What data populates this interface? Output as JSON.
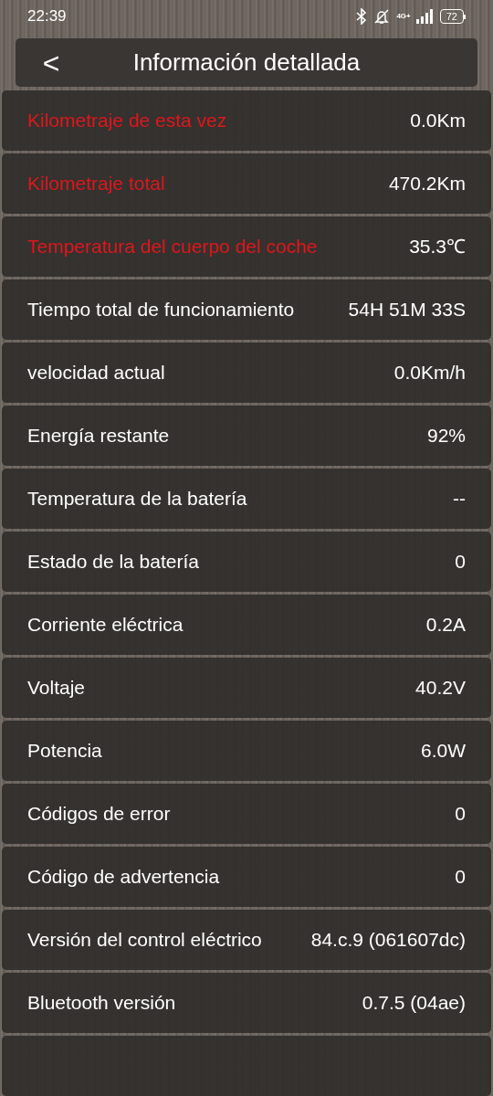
{
  "status_bar": {
    "time": "22:39",
    "network": "4G+",
    "battery": "72"
  },
  "header": {
    "back": "<",
    "title": "Información detallada"
  },
  "rows": [
    {
      "label": "Kilometraje de esta vez",
      "value": "0.0Km",
      "highlight": true
    },
    {
      "label": "Kilometraje total",
      "value": "470.2Km",
      "highlight": true
    },
    {
      "label": "Temperatura del cuerpo del coche",
      "value": "35.3℃",
      "highlight": true
    },
    {
      "label": "Tiempo total de funcionamiento",
      "value": "54H 51M 33S",
      "highlight": false
    },
    {
      "label": "velocidad actual",
      "value": "0.0Km/h",
      "highlight": false
    },
    {
      "label": "Energía restante",
      "value": "92%",
      "highlight": false
    },
    {
      "label": "Temperatura de la batería",
      "value": "--",
      "highlight": false
    },
    {
      "label": "Estado de la batería",
      "value": "0",
      "highlight": false
    },
    {
      "label": "Corriente eléctrica",
      "value": "0.2A",
      "highlight": false
    },
    {
      "label": "Voltaje",
      "value": "40.2V",
      "highlight": false
    },
    {
      "label": "Potencia",
      "value": "6.0W",
      "highlight": false
    },
    {
      "label": "Códigos de error",
      "value": "0",
      "highlight": false
    },
    {
      "label": "Código de advertencia",
      "value": "0",
      "highlight": false
    },
    {
      "label": "Versión del control eléctrico",
      "value": "84.c.9 (061607dc)",
      "highlight": false
    },
    {
      "label": "Bluetooth versión",
      "value": "0.7.5 (04ae)",
      "highlight": false
    }
  ]
}
